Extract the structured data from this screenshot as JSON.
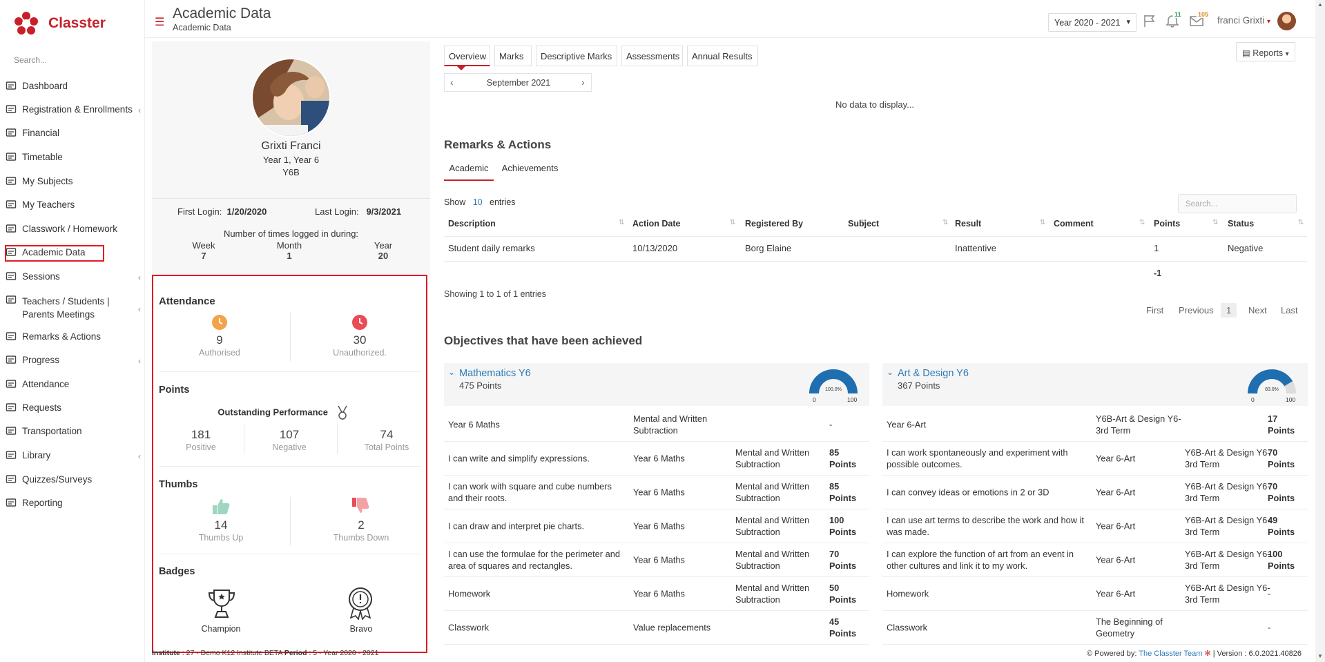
{
  "app": {
    "brand": "Classter"
  },
  "sidebar": {
    "search_placeholder": "Search...",
    "items": [
      {
        "label": "Dashboard",
        "icon": "laptop-icon",
        "chev": ""
      },
      {
        "label": "Registration & Enrollments",
        "icon": "bank-icon",
        "chev": "‹"
      },
      {
        "label": "Financial",
        "icon": "coins-icon",
        "chev": ""
      },
      {
        "label": "Timetable",
        "icon": "calendar-icon",
        "chev": ""
      },
      {
        "label": "My Subjects",
        "icon": "book-icon",
        "chev": ""
      },
      {
        "label": "My Teachers",
        "icon": "users-icon",
        "chev": ""
      },
      {
        "label": "Classwork / Homework",
        "icon": "list-icon",
        "chev": ""
      },
      {
        "label": "Academic Data",
        "icon": "id-card-icon",
        "chev": ""
      },
      {
        "label": "Sessions",
        "icon": "presentation-icon",
        "chev": "‹"
      },
      {
        "label": "Teachers / Students | Parents Meetings",
        "icon": "meeting-icon",
        "chev": "‹"
      },
      {
        "label": "Remarks & Actions",
        "icon": "shuffle-icon",
        "chev": ""
      },
      {
        "label": "Progress",
        "icon": "graduation-cap-icon",
        "chev": "‹"
      },
      {
        "label": "Attendance",
        "icon": "user-check-icon",
        "chev": ""
      },
      {
        "label": "Requests",
        "icon": "document-icon",
        "chev": ""
      },
      {
        "label": "Transportation",
        "icon": "bus-icon",
        "chev": ""
      },
      {
        "label": "Library",
        "icon": "books-icon",
        "chev": "‹"
      },
      {
        "label": "Quizzes/Surveys",
        "icon": "clipboard-icon",
        "chev": ""
      },
      {
        "label": "Reporting",
        "icon": "printer-icon",
        "chev": ""
      }
    ]
  },
  "header": {
    "title": "Academic Data",
    "subtitle": "Academic Data",
    "year": "Year 2020 - 2021",
    "notif_count": "11",
    "msg_count": "105",
    "user": "franci Grixti"
  },
  "profile": {
    "name": "Grixti Franci",
    "year": "Year 1, Year 6",
    "class": "Y6B",
    "first_login_label": "First Login:",
    "first_login": "1/20/2020",
    "last_login_label": "Last Login:",
    "last_login": "9/3/2021",
    "logged_label": "Number of times logged in during:",
    "week_label": "Week",
    "week": "7",
    "month_label": "Month",
    "month": "1",
    "year_label": "Year",
    "year_count": "20"
  },
  "stats": {
    "attendance_title": "Attendance",
    "authorised": "9",
    "authorised_label": "Authorised",
    "unauthorized": "30",
    "unauthorized_label": "Unauthorized.",
    "points_title": "Points",
    "performance": "Outstanding Performance",
    "positive": "181",
    "positive_label": "Positive",
    "negative": "107",
    "negative_label": "Negative",
    "total": "74",
    "total_label": "Total Points",
    "thumbs_title": "Thumbs",
    "thumbs_up": "14",
    "thumbs_up_label": "Thumbs Up",
    "thumbs_down": "2",
    "thumbs_down_label": "Thumbs Down",
    "badges_title": "Badges",
    "badge1": "Champion",
    "badge2": "Bravo"
  },
  "tabs": [
    "Overview",
    "Marks",
    "Descriptive Marks",
    "Assessments",
    "Annual Results"
  ],
  "reports_label": "Reports",
  "month_nav": "September 2021",
  "no_data": "No data to display...",
  "remarks": {
    "title": "Remarks & Actions",
    "subtabs": [
      "Academic",
      "Achievements"
    ],
    "show": "Show",
    "entries_count": "10",
    "entries": "entries",
    "search_placeholder": "Search...",
    "columns": [
      "Description",
      "Action Date",
      "Registered By",
      "Subject",
      "Result",
      "Comment",
      "Points",
      "Status"
    ],
    "row": [
      "Student daily remarks",
      "10/13/2020",
      "Borg Elaine",
      "",
      "Inattentive",
      "",
      "1",
      "Negative"
    ],
    "total": "-1",
    "showing": "Showing 1 to 1 of 1 entries",
    "pager": [
      "First",
      "Previous",
      "1",
      "Next",
      "Last"
    ]
  },
  "objectives": {
    "title": "Objectives that have been achieved",
    "left": {
      "title": "Mathematics Y6",
      "points": "475 Points",
      "gauge": "100.0%",
      "gauge_value": 100,
      "gmin": "0",
      "gmax": "100",
      "rows": [
        [
          "Year 6 Maths",
          "Mental and Written Subtraction",
          "",
          "-"
        ],
        [
          "I can write and simplify expressions.",
          "Year 6 Maths",
          "Mental and Written Subtraction",
          "85 Points"
        ],
        [
          "I can work with square and cube numbers and their roots.",
          "Year 6 Maths",
          "Mental and Written Subtraction",
          "85 Points"
        ],
        [
          "I can draw and interpret pie charts.",
          "Year 6 Maths",
          "Mental and Written Subtraction",
          "100 Points"
        ],
        [
          "I can use the formulae for the perimeter and area of squares and rectangles.",
          "Year 6 Maths",
          "Mental and Written Subtraction",
          "70 Points"
        ],
        [
          "Homework",
          "Year 6 Maths",
          "Mental and Written Subtraction",
          "50 Points"
        ],
        [
          "Classwork",
          "Value replacements",
          "",
          "45 Points"
        ]
      ]
    },
    "right": {
      "title": "Art & Design Y6",
      "points": "367 Points",
      "gauge": "83.0%",
      "gauge_value": 83,
      "gmin": "0",
      "gmax": "100",
      "rows": [
        [
          "Year 6-Art",
          "Y6B-Art & Design Y6-3rd Term",
          "",
          "17 Points"
        ],
        [
          "I can work spontaneously and experiment with possible outcomes.",
          "Year 6-Art",
          "Y6B-Art & Design Y6-3rd Term",
          "70 Points"
        ],
        [
          "I can convey ideas or emotions in 2 or 3D",
          "Year 6-Art",
          "Y6B-Art & Design Y6-3rd Term",
          "70 Points"
        ],
        [
          "I can use art terms to describe the work and how it was made.",
          "Year 6-Art",
          "Y6B-Art & Design Y6-3rd Term",
          "49 Points"
        ],
        [
          "I can explore the function of art from an event in other cultures and link it to my work.",
          "Year 6-Art",
          "Y6B-Art & Design Y6-3rd Term",
          "100 Points"
        ],
        [
          "Homework",
          "Year 6-Art",
          "Y6B-Art & Design Y6-3rd Term",
          "-"
        ],
        [
          "Classwork",
          "The Beginning of Geometry",
          "",
          "-"
        ]
      ]
    }
  },
  "footer": {
    "institute_label": "Institute",
    "institute": ": 27 - Demo K12 Institute BETA",
    "period_label": "Period",
    "period": ": 5 - Year 2020 - 2021",
    "powered": "Powered by:",
    "team": "The Classter Team",
    "version": "| Version : 6.0.2021.40826"
  }
}
